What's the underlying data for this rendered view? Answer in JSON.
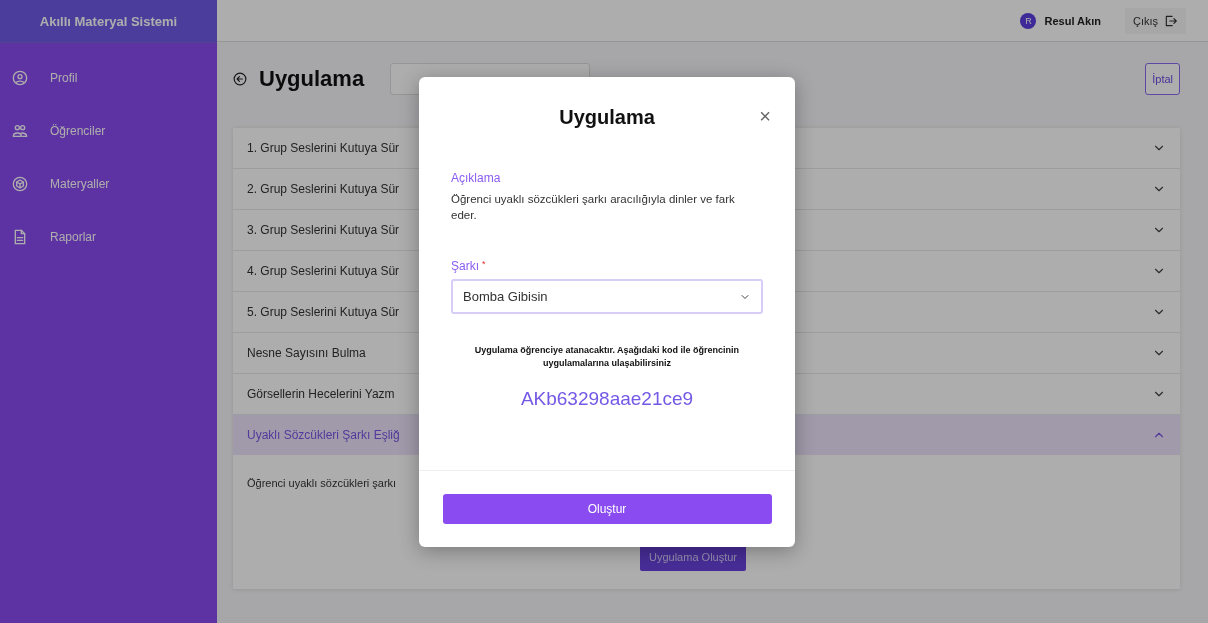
{
  "app_title": "Akıllı Materyal Sistemi",
  "sidebar": {
    "items": [
      {
        "label": "Profil",
        "kind": "profile"
      },
      {
        "label": "Öğrenciler",
        "kind": "people"
      },
      {
        "label": "Materyaller",
        "kind": "cube"
      },
      {
        "label": "Raporlar",
        "kind": "document"
      }
    ]
  },
  "header": {
    "user_initial": "R",
    "user_name": "Resul Akın",
    "logout": "Çıkış"
  },
  "page": {
    "title": "Uygulama",
    "cancel": "İptal"
  },
  "accordion": [
    {
      "title": "1. Grup Seslerini Kutuya Sür",
      "expanded": false
    },
    {
      "title": "2. Grup Seslerini Kutuya Sür",
      "expanded": false
    },
    {
      "title": "3. Grup Seslerini Kutuya Sür",
      "expanded": false
    },
    {
      "title": "4. Grup Seslerini Kutuya Sür",
      "expanded": false
    },
    {
      "title": "5. Grup Seslerini Kutuya Sür",
      "expanded": false
    },
    {
      "title": "Nesne Sayısını Bulma",
      "expanded": false
    },
    {
      "title": "Görsellerin Hecelerini Yazm",
      "expanded": false
    },
    {
      "title": "Uyaklı Sözcükleri Şarkı Eşliğ",
      "expanded": true,
      "body": "Öğrenci uyaklı sözcükleri şarkı",
      "button": "Uygulama Oluştur"
    }
  ],
  "modal": {
    "title": "Uygulama",
    "close": "×",
    "description_label": "Açıklama",
    "description": "Öğrenci uyaklı sözcükleri şarkı aracılığıyla dinler ve fark eder.",
    "song_label": "Şarkı",
    "required_mark": "*",
    "song_value": "Bomba Gibisin",
    "info": "Uygulama öğrenciye atanacaktır. Aşağıdaki kod ile öğrencinin uygulamalarına ulaşabilirsiniz",
    "code": "AKb63298aae21ce9",
    "submit": "Oluştur"
  }
}
